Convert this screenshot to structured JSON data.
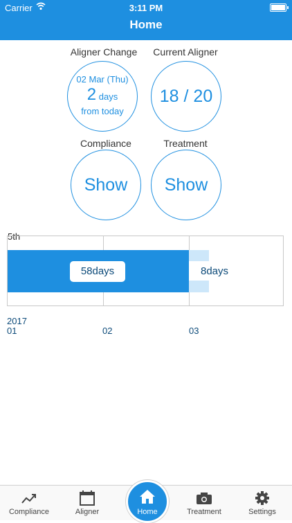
{
  "status": {
    "carrier": "Carrier",
    "time": "3:11 PM"
  },
  "header": {
    "title": "Home"
  },
  "widgets": {
    "aligner_change": {
      "label": "Aligner Change",
      "date": "02 Mar (Thu)",
      "days_number": "2",
      "days_unit": "days",
      "suffix": "from today"
    },
    "current_aligner": {
      "label": "Current Aligner",
      "value": "18 / 20"
    },
    "compliance": {
      "label": "Compliance",
      "button": "Show"
    },
    "treatment": {
      "label": "Treatment",
      "button": "Show"
    }
  },
  "chart_data": {
    "type": "bar",
    "row_label": "5th",
    "segments": [
      {
        "label": "58days",
        "days": 58,
        "status": "elapsed",
        "color": "#1e8fe0"
      },
      {
        "label": "8days",
        "days": 8,
        "status": "remaining",
        "color": "#cde7fa"
      }
    ],
    "x_ticks": [
      {
        "year": "2017",
        "month": "01"
      },
      {
        "year": "",
        "month": "02"
      },
      {
        "year": "",
        "month": "03"
      }
    ]
  },
  "tabs": [
    {
      "label": "Compliance",
      "icon": "trend-icon"
    },
    {
      "label": "Aligner",
      "icon": "calendar-icon"
    },
    {
      "label": "Home",
      "icon": "home-icon"
    },
    {
      "label": "Treatment",
      "icon": "camera-icon"
    },
    {
      "label": "Settings",
      "icon": "gear-icon"
    }
  ]
}
